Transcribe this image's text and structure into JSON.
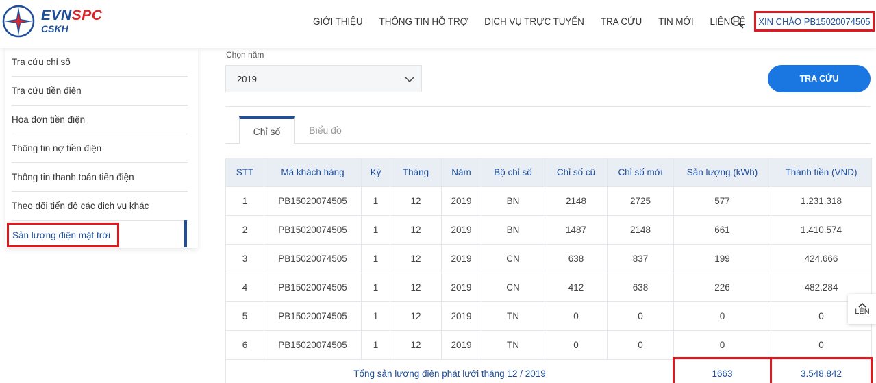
{
  "header": {
    "brand_evn": "EVN",
    "brand_spc": "SPC",
    "brand_sub": "CSKH",
    "nav": [
      "GIỚI THIỆU",
      "THÔNG TIN HỖ TRỢ",
      "DỊCH VỤ TRỰC TUYẾN",
      "TRA CỨU",
      "TIN MỚI",
      "LIÊN HỆ"
    ],
    "greeting": "XIN CHÀO PB15020074505"
  },
  "sidebar": {
    "items": [
      "Tra cứu chỉ số",
      "Tra cứu tiền điện",
      "Hóa đơn tiền điện",
      "Thông tin nợ tiền điện",
      "Thông tin thanh toán tiền điện",
      "Theo dõi tiến độ các dịch vụ khác"
    ],
    "active": "Sản lượng điện mặt trời"
  },
  "filter": {
    "label": "Chọn năm",
    "value": "2019",
    "button": "TRA CỨU"
  },
  "tabs": [
    "Chỉ số",
    "Biểu đồ"
  ],
  "table": {
    "headers": [
      "STT",
      "Mã khách hàng",
      "Kỳ",
      "Tháng",
      "Năm",
      "Bộ chỉ số",
      "Chỉ số cũ",
      "Chỉ số mới",
      "Sản lượng (kWh)",
      "Thành tiền (VND)"
    ],
    "rows": [
      [
        "1",
        "PB15020074505",
        "1",
        "12",
        "2019",
        "BN",
        "2148",
        "2725",
        "577",
        "1.231.318"
      ],
      [
        "2",
        "PB15020074505",
        "1",
        "12",
        "2019",
        "BN",
        "1487",
        "2148",
        "661",
        "1.410.574"
      ],
      [
        "3",
        "PB15020074505",
        "1",
        "12",
        "2019",
        "CN",
        "638",
        "837",
        "199",
        "424.666"
      ],
      [
        "4",
        "PB15020074505",
        "1",
        "12",
        "2019",
        "CN",
        "412",
        "638",
        "226",
        "482.284"
      ],
      [
        "5",
        "PB15020074505",
        "1",
        "12",
        "2019",
        "TN",
        "0",
        "0",
        "0",
        "0"
      ],
      [
        "6",
        "PB15020074505",
        "1",
        "12",
        "2019",
        "TN",
        "0",
        "0",
        "0",
        "0"
      ]
    ],
    "total_label": "Tổng sản lượng điện phát lưới tháng 12 / 2019",
    "total_kwh": "1663",
    "total_vnd": "3.548.842"
  },
  "to_top": "LÊN",
  "colors": {
    "brand_blue": "#1e4f9c",
    "brand_red": "#e0242b",
    "button_blue": "#1a76e0",
    "highlight_red": "#e3181f"
  }
}
